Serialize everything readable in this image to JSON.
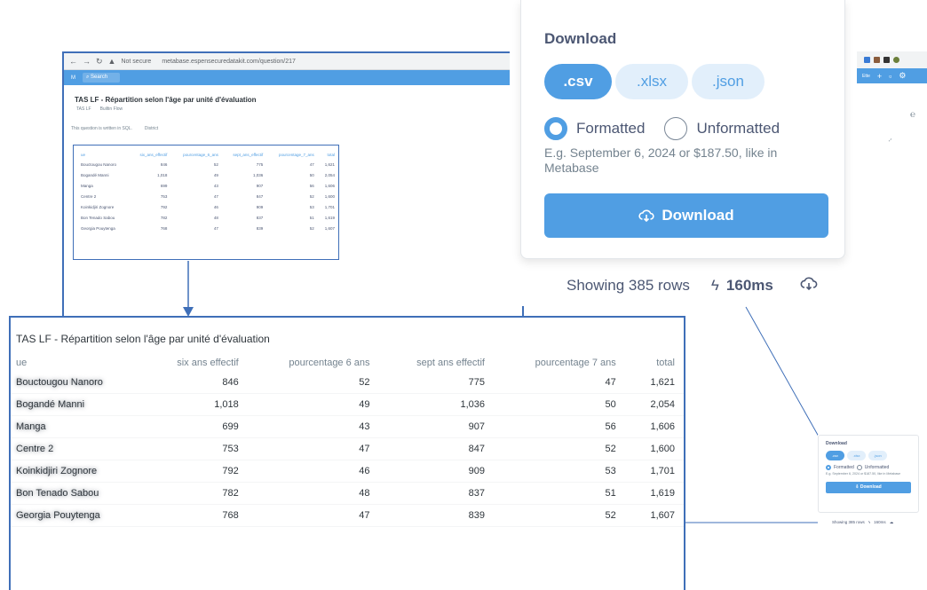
{
  "browser": {
    "url": "metabase.espensecuredatakit.com/question/217",
    "not_secure": "Not secure",
    "search": "Search",
    "question_title": "TAS LF - Répartition selon l'âge par unité d'évaluation",
    "collection": "TAS LF",
    "builder": "Builtin Flow",
    "sql_note": "This question is written in SQL.",
    "district": "District",
    "right_label": "Ette"
  },
  "download": {
    "title": "Download",
    "formats": [
      ".csv",
      ".xlsx",
      ".json"
    ],
    "selected_format": ".csv",
    "formatted_label": "Formatted",
    "unformatted_label": "Unformatted",
    "hint": "E.g. September 6, 2024 or $187.50, like in Metabase",
    "button_label": "Download",
    "rows_text": "Showing 385 rows",
    "timing": "160ms"
  },
  "thumbnail": {
    "rows_text": "Showing 385 rows",
    "timing": "160ms"
  },
  "table": {
    "title": "TAS LF - Répartition selon l'âge par unité d'évaluation",
    "columns": [
      "ue",
      "six ans effectif",
      "pourcentage 6 ans",
      "sept ans effectif",
      "pourcentage 7 ans",
      "total"
    ],
    "mini_columns": [
      "ue",
      "six_ans_effectif",
      "pourcentage_6_ans",
      "sept_ans_effectif",
      "pourcentage_7_ans",
      "total"
    ],
    "rows": [
      {
        "ue": "Bouctougou Nanoro",
        "six": "846",
        "p6": "52",
        "sept": "775",
        "p7": "47",
        "total": "1,621"
      },
      {
        "ue": "Bogandé Manni",
        "six": "1,018",
        "p6": "49",
        "sept": "1,036",
        "p7": "50",
        "total": "2,054"
      },
      {
        "ue": "Manga",
        "six": "699",
        "p6": "43",
        "sept": "907",
        "p7": "56",
        "total": "1,606"
      },
      {
        "ue": "Centre 2",
        "six": "753",
        "p6": "47",
        "sept": "847",
        "p7": "52",
        "total": "1,600"
      },
      {
        "ue": "Koinkidjiri Zognore",
        "six": "792",
        "p6": "46",
        "sept": "909",
        "p7": "53",
        "total": "1,701"
      },
      {
        "ue": "Bon Tenado Sabou",
        "six": "782",
        "p6": "48",
        "sept": "837",
        "p7": "51",
        "total": "1,619"
      },
      {
        "ue": "Georgia Pouytenga",
        "six": "768",
        "p6": "47",
        "sept": "839",
        "p7": "52",
        "total": "1,607"
      }
    ]
  },
  "colors": {
    "brand": "#509ee3",
    "brand_light": "#e2effb",
    "text": "#4c5773",
    "frame": "#3f6fb8"
  }
}
